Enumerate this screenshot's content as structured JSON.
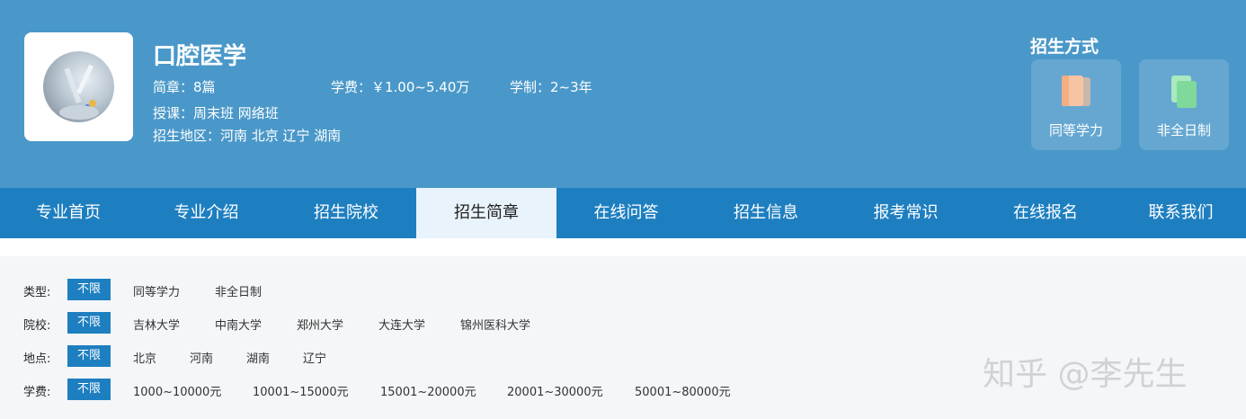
{
  "header": {
    "title": "口腔医学",
    "brochures": "简章：8篇",
    "tuition": "学费：￥1.00~5.40万",
    "duration": "学制：2~3年",
    "teaching": "授课：周末班 网络班",
    "regions": "招生地区：河南 北京 辽宁 湖南"
  },
  "enroll_modes": {
    "title": "招生方式",
    "items": [
      {
        "label": "同等学力",
        "icon": "document-orange-icon",
        "color": "#f6b995"
      },
      {
        "label": "非全日制",
        "icon": "document-green-icon",
        "color": "#8fe0a8"
      }
    ]
  },
  "nav": {
    "items": [
      "专业首页",
      "专业介绍",
      "招生院校",
      "招生简章",
      "在线问答",
      "招生信息",
      "报考常识",
      "在线报名",
      "联系我们"
    ],
    "active": "招生简章"
  },
  "filters": {
    "type": {
      "label": "类型:",
      "all": "不限",
      "options": [
        "同等学力",
        "非全日制"
      ]
    },
    "school": {
      "label": "院校:",
      "all": "不限",
      "options": [
        "吉林大学",
        "中南大学",
        "郑州大学",
        "大连大学",
        "锦州医科大学"
      ]
    },
    "location": {
      "label": "地点:",
      "all": "不限",
      "options": [
        "北京",
        "河南",
        "湖南",
        "辽宁"
      ]
    },
    "fee": {
      "label": "学费:",
      "all": "不限",
      "options": [
        "1000~10000元",
        "10001~15000元",
        "15001~20000元",
        "20001~30000元",
        "50001~80000元"
      ]
    }
  },
  "watermark": "知乎 @李先生",
  "colors": {
    "header_bg": "#4a98c9",
    "nav_bg": "#1e7fc0",
    "active_tab_bg": "#e8f3fb",
    "tag_bg": "#1e7fc0"
  }
}
